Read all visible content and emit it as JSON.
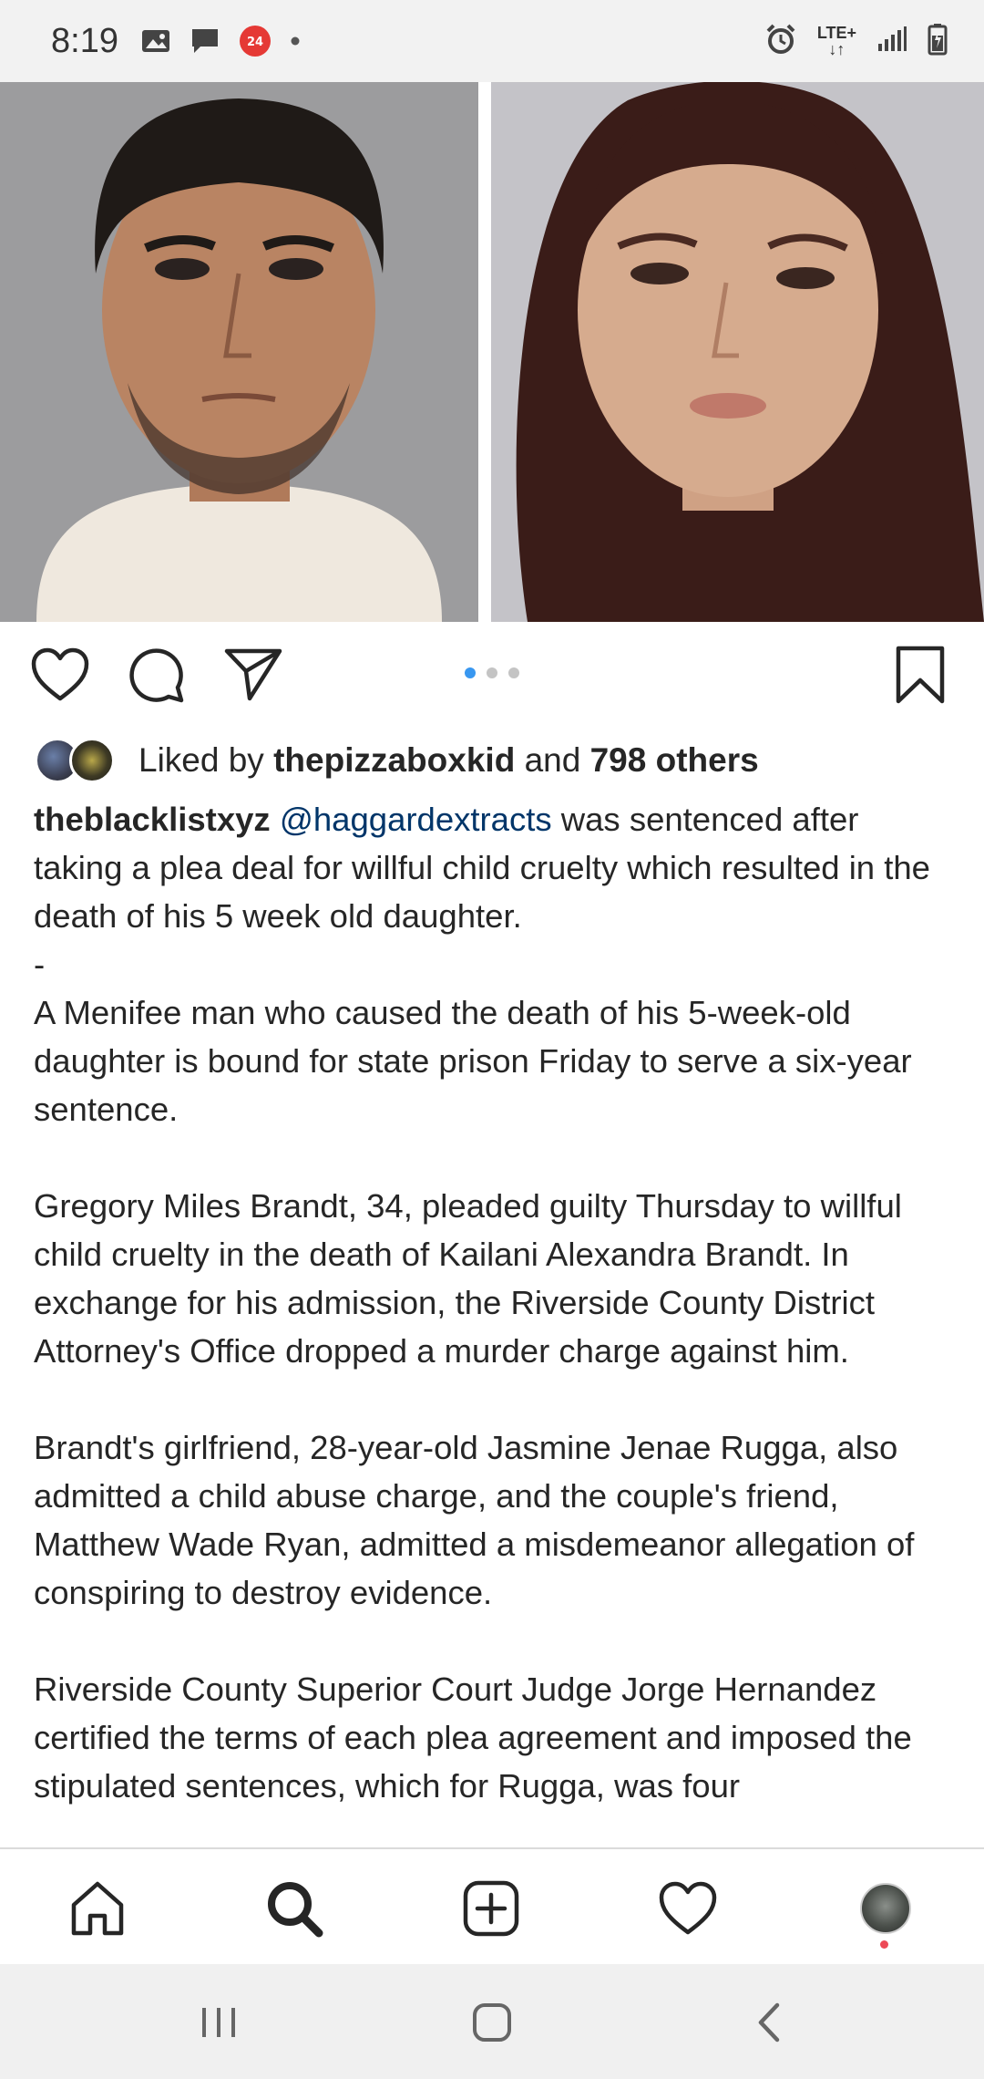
{
  "status_bar": {
    "time": "8:19",
    "network_label": "LTE+",
    "icons": [
      "gallery-icon",
      "message-icon",
      "app-badge-icon",
      "dot-icon",
      "alarm-icon",
      "lte-icon",
      "signal-icon",
      "battery-icon"
    ]
  },
  "post": {
    "image_alt": "two mugshot photos side by side",
    "carousel": {
      "count": 3,
      "active_index": 0
    },
    "likes": {
      "prefix": "Liked by ",
      "user": "thepizzaboxkid",
      "joiner": " and ",
      "others": "798 others"
    },
    "caption": {
      "username": "theblacklistxyz",
      "mention": "@haggardextracts",
      "text": " was sentenced after taking a plea deal for willful child cruelty which resulted in the death of his 5 week old daughter.\n-\nA Menifee man who caused the death of his 5-week-old daughter is bound for state prison Friday to serve a six-year sentence.\n\nGregory Miles Brandt, 34, pleaded guilty Thursday to willful child cruelty in the death of Kailani Alexandra Brandt. In exchange for his admission, the Riverside County District Attorney's Office dropped a murder charge against him.\n\nBrandt's girlfriend, 28-year-old Jasmine Jenae Rugga, also admitted a child abuse charge, and the couple's friend, Matthew Wade Ryan, admitted a misdemeanor allegation of conspiring to destroy evidence.\n\nRiverside County Superior Court Judge Jorge Hernandez certified the terms of each plea agreement and imposed the stipulated sentences, which for Rugga, was four"
    }
  },
  "bottom_nav": [
    "home-icon",
    "search-icon",
    "new-post-icon",
    "activity-heart-icon",
    "profile-avatar"
  ],
  "system_nav": [
    "recent-apps-icon",
    "home-button-icon",
    "back-icon"
  ],
  "colors": {
    "accent_blue": "#3897f0",
    "mention": "#003569",
    "notification": "#ed4956"
  }
}
